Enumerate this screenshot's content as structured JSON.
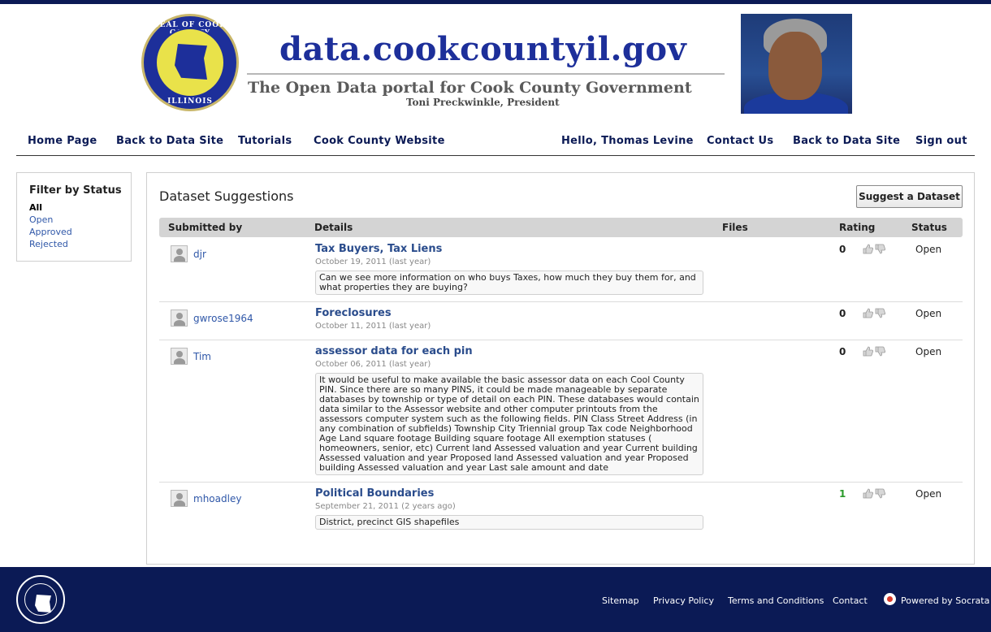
{
  "header": {
    "site_title": "data.cookcountyil.gov",
    "subtitle": "The Open Data portal for Cook County Government",
    "president": "Toni Preckwinkle, President",
    "seal_text_top": "SEAL OF COOK COUNTY",
    "seal_text_bottom": "ILLINOIS"
  },
  "nav": {
    "left": [
      "Home Page",
      "Back to Data Site",
      "Tutorials",
      "Cook County Website"
    ],
    "right": [
      "Hello, Thomas Levine",
      "Contact Us",
      "Back to Data Site",
      "Sign out"
    ]
  },
  "sidebar": {
    "title": "Filter by Status",
    "items": [
      "All",
      "Open",
      "Approved",
      "Rejected"
    ],
    "active": "All"
  },
  "main": {
    "title": "Dataset Suggestions",
    "suggest_button": "Suggest a Dataset",
    "columns": [
      "Submitted by",
      "Details",
      "Files",
      "Rating",
      "Status"
    ],
    "rows": [
      {
        "user": "djr",
        "title": "Tax Buyers, Tax Liens",
        "date": "October 19, 2011 (last year)",
        "description": "Can we see more information on who buys Taxes, how much they buy them for, and what properties they are buying?",
        "rating": "0",
        "status": "Open"
      },
      {
        "user": "gwrose1964",
        "title": "Foreclosures",
        "date": "October 11, 2011 (last year)",
        "description": "",
        "rating": "0",
        "status": "Open"
      },
      {
        "user": "Tim",
        "title": "assessor data for each pin",
        "date": "October 06, 2011 (last year)",
        "description": "It would be useful to make available the basic assessor data on each Cool County PIN. Since there are so many PINS, it could be made manageable by separate databases by township or type of detail on each PIN. These databases would contain data similar to the Assessor website and other computer printouts from the assessors computer system such as the following fields. PIN Class Street Address (in any combination of subfields) Township City Triennial group Tax code Neighborhood Age Land square footage Building square footage All exemption statuses ( homeowners, senior, etc) Current land Assessed valuation and year Current building Assessed valuation and year Proposed land Assessed valuation and year Proposed building Assessed valuation and year Last sale amount and date",
        "rating": "0",
        "status": "Open"
      },
      {
        "user": "mhoadley",
        "title": "Political Boundaries",
        "date": "September 21, 2011 (2 years ago)",
        "description": "District, precinct GIS shapefiles",
        "rating": "1",
        "status": "Open"
      }
    ]
  },
  "footer": {
    "links": [
      "Sitemap",
      "Privacy Policy",
      "Terms and Conditions",
      "Contact",
      "Powered by Socrata"
    ]
  },
  "colors": {
    "navy": "#0b1a55",
    "link": "#2f57a8",
    "positive": "#2a9a2a"
  }
}
